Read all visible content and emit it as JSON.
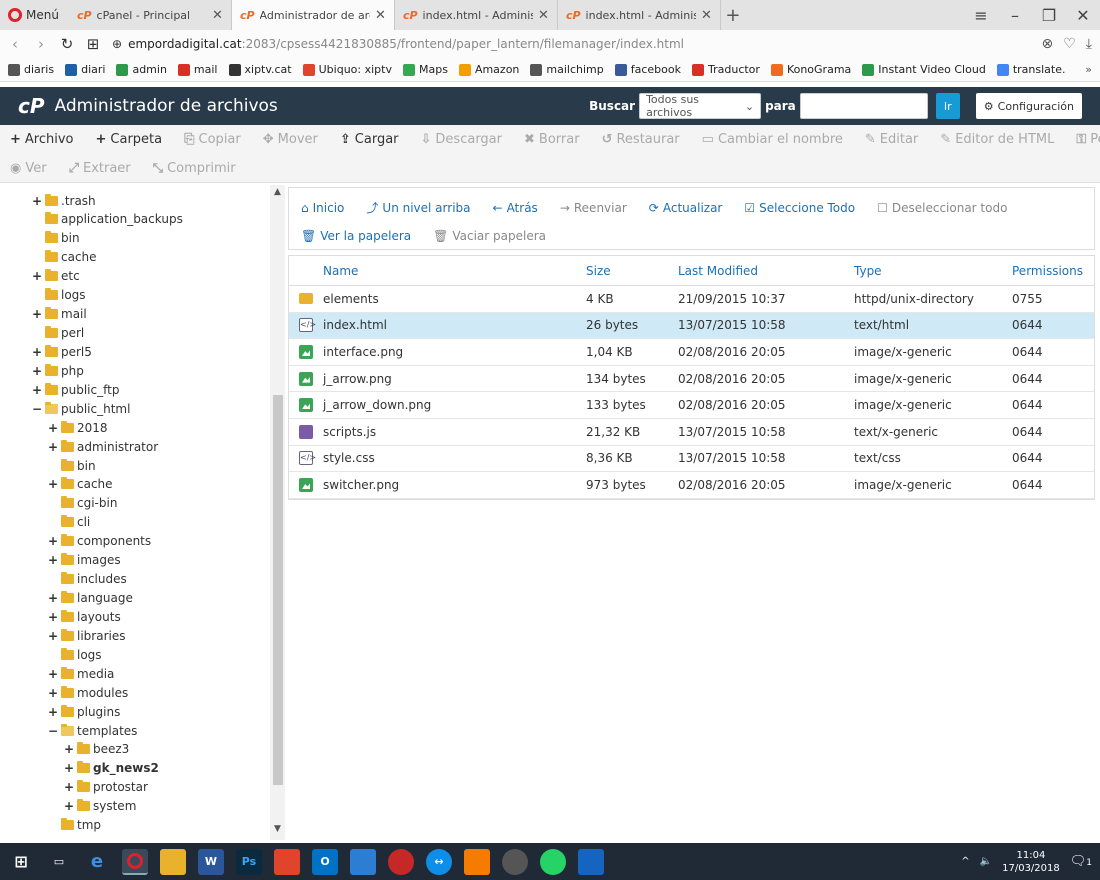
{
  "browser": {
    "menu_label": "Menú",
    "tabs": [
      {
        "title": "cPanel - Principal",
        "active": false
      },
      {
        "title": "Administrador de archivos",
        "active": true
      },
      {
        "title": "index.html - Administrado",
        "active": false
      },
      {
        "title": "index.html - Administrado",
        "active": false
      }
    ],
    "url_host": "empordadigital.cat",
    "url_rest": ":2083/cpsess4421830885/frontend/paper_lantern/filemanager/index.html",
    "bookmarks": [
      {
        "label": "diaris",
        "color": "#555555"
      },
      {
        "label": "diari",
        "color": "#1e5fa8"
      },
      {
        "label": "admin",
        "color": "#2c9a4a"
      },
      {
        "label": "mail",
        "color": "#d93025"
      },
      {
        "label": "xiptv.cat",
        "color": "#333333"
      },
      {
        "label": "Ubiquo: xiptv",
        "color": "#e0442a"
      },
      {
        "label": "Maps",
        "color": "#34a853"
      },
      {
        "label": "Amazon",
        "color": "#f0a000"
      },
      {
        "label": "mailchimp",
        "color": "#555555"
      },
      {
        "label": "facebook",
        "color": "#3b5998"
      },
      {
        "label": "Traductor",
        "color": "#d93025"
      },
      {
        "label": "KonoGrama",
        "color": "#f06a1f"
      },
      {
        "label": "Instant Video Cloud",
        "color": "#2c9a4a"
      },
      {
        "label": "translate.",
        "color": "#4285f4"
      }
    ]
  },
  "cpanel": {
    "logo": "cP",
    "title": "Administrador de archivos",
    "search_label": "Buscar",
    "search_scope": "Todos sus archivos",
    "for_label": "para",
    "go_label": "Ir",
    "config_label": "Configuración"
  },
  "toolbar": {
    "row1": [
      {
        "icon": "+",
        "label": "Archivo",
        "enabled": true
      },
      {
        "icon": "+",
        "label": "Carpeta",
        "enabled": true
      },
      {
        "icon": "⎘",
        "label": "Copiar",
        "enabled": false
      },
      {
        "icon": "✥",
        "label": "Mover",
        "enabled": false
      },
      {
        "icon": "⇪",
        "label": "Cargar",
        "enabled": true
      },
      {
        "icon": "⇩",
        "label": "Descargar",
        "enabled": false
      },
      {
        "icon": "✖",
        "label": "Borrar",
        "enabled": false
      },
      {
        "icon": "↺",
        "label": "Restaurar",
        "enabled": false
      },
      {
        "icon": "▭",
        "label": "Cambiar el nombre",
        "enabled": false
      },
      {
        "icon": "✎",
        "label": "Editar",
        "enabled": false
      },
      {
        "icon": "✎",
        "label": "Editor de HTML",
        "enabled": false
      },
      {
        "icon": "⚿",
        "label": "Permisos",
        "enabled": false
      }
    ],
    "row2": [
      {
        "icon": "◉",
        "label": "Ver",
        "enabled": false
      },
      {
        "icon": "⤢",
        "label": "Extraer",
        "enabled": false
      },
      {
        "icon": "⤡",
        "label": "Comprimir",
        "enabled": false
      }
    ]
  },
  "tree": [
    {
      "label": ".trash",
      "depth": 0,
      "toggle": "+",
      "open": false,
      "bold": false
    },
    {
      "label": "application_backups",
      "depth": 0,
      "toggle": "",
      "open": false,
      "bold": false
    },
    {
      "label": "bin",
      "depth": 0,
      "toggle": "",
      "open": false,
      "bold": false
    },
    {
      "label": "cache",
      "depth": 0,
      "toggle": "",
      "open": false,
      "bold": false
    },
    {
      "label": "etc",
      "depth": 0,
      "toggle": "+",
      "open": false,
      "bold": false
    },
    {
      "label": "logs",
      "depth": 0,
      "toggle": "",
      "open": false,
      "bold": false
    },
    {
      "label": "mail",
      "depth": 0,
      "toggle": "+",
      "open": false,
      "bold": false
    },
    {
      "label": "perl",
      "depth": 0,
      "toggle": "",
      "open": false,
      "bold": false
    },
    {
      "label": "perl5",
      "depth": 0,
      "toggle": "+",
      "open": false,
      "bold": false
    },
    {
      "label": "php",
      "depth": 0,
      "toggle": "+",
      "open": false,
      "bold": false
    },
    {
      "label": "public_ftp",
      "depth": 0,
      "toggle": "+",
      "open": false,
      "bold": false
    },
    {
      "label": "public_html",
      "depth": 0,
      "toggle": "−",
      "open": true,
      "bold": false
    },
    {
      "label": "2018",
      "depth": 1,
      "toggle": "+",
      "open": false,
      "bold": false
    },
    {
      "label": "administrator",
      "depth": 1,
      "toggle": "+",
      "open": false,
      "bold": false
    },
    {
      "label": "bin",
      "depth": 1,
      "toggle": "",
      "open": false,
      "bold": false
    },
    {
      "label": "cache",
      "depth": 1,
      "toggle": "+",
      "open": false,
      "bold": false
    },
    {
      "label": "cgi-bin",
      "depth": 1,
      "toggle": "",
      "open": false,
      "bold": false
    },
    {
      "label": "cli",
      "depth": 1,
      "toggle": "",
      "open": false,
      "bold": false
    },
    {
      "label": "components",
      "depth": 1,
      "toggle": "+",
      "open": false,
      "bold": false
    },
    {
      "label": "images",
      "depth": 1,
      "toggle": "+",
      "open": false,
      "bold": false
    },
    {
      "label": "includes",
      "depth": 1,
      "toggle": "",
      "open": false,
      "bold": false
    },
    {
      "label": "language",
      "depth": 1,
      "toggle": "+",
      "open": false,
      "bold": false
    },
    {
      "label": "layouts",
      "depth": 1,
      "toggle": "+",
      "open": false,
      "bold": false
    },
    {
      "label": "libraries",
      "depth": 1,
      "toggle": "+",
      "open": false,
      "bold": false
    },
    {
      "label": "logs",
      "depth": 1,
      "toggle": "",
      "open": false,
      "bold": false
    },
    {
      "label": "media",
      "depth": 1,
      "toggle": "+",
      "open": false,
      "bold": false
    },
    {
      "label": "modules",
      "depth": 1,
      "toggle": "+",
      "open": false,
      "bold": false
    },
    {
      "label": "plugins",
      "depth": 1,
      "toggle": "+",
      "open": false,
      "bold": false
    },
    {
      "label": "templates",
      "depth": 1,
      "toggle": "−",
      "open": true,
      "bold": false
    },
    {
      "label": "beez3",
      "depth": 2,
      "toggle": "+",
      "open": false,
      "bold": false
    },
    {
      "label": "gk_news2",
      "depth": 2,
      "toggle": "+",
      "open": false,
      "bold": true
    },
    {
      "label": "protostar",
      "depth": 2,
      "toggle": "+",
      "open": false,
      "bold": false
    },
    {
      "label": "system",
      "depth": 2,
      "toggle": "+",
      "open": false,
      "bold": false
    },
    {
      "label": "tmp",
      "depth": 1,
      "toggle": "",
      "open": false,
      "bold": false
    }
  ],
  "nav": {
    "row1": [
      {
        "icon": "⌂",
        "label": "Inicio",
        "enabled": true
      },
      {
        "icon": "⤴",
        "label": "Un nivel arriba",
        "enabled": true
      },
      {
        "icon": "←",
        "label": "Atrás",
        "enabled": true
      },
      {
        "icon": "→",
        "label": "Reenviar",
        "enabled": false
      },
      {
        "icon": "⟳",
        "label": "Actualizar",
        "enabled": true
      },
      {
        "icon": "☑",
        "label": "Seleccione Todo",
        "enabled": true
      },
      {
        "icon": "☐",
        "label": "Deseleccionar todo",
        "enabled": false
      }
    ],
    "row2": [
      {
        "icon": "🗑",
        "label": "Ver la papelera",
        "enabled": true
      },
      {
        "icon": "🗑",
        "label": "Vaciar papelera",
        "enabled": false
      }
    ]
  },
  "files": {
    "headers": {
      "name": "Name",
      "size": "Size",
      "modified": "Last Modified",
      "type": "Type",
      "perms": "Permissions"
    },
    "rows": [
      {
        "kind": "dir",
        "name": "elements",
        "size": "4 KB",
        "modified": "21/09/2015 10:37",
        "type": "httpd/unix-directory",
        "perms": "0755",
        "selected": false
      },
      {
        "kind": "code",
        "name": "index.html",
        "size": "26 bytes",
        "modified": "13/07/2015 10:58",
        "type": "text/html",
        "perms": "0644",
        "selected": true
      },
      {
        "kind": "img",
        "name": "interface.png",
        "size": "1,04 KB",
        "modified": "02/08/2016 20:05",
        "type": "image/x-generic",
        "perms": "0644",
        "selected": false
      },
      {
        "kind": "img",
        "name": "j_arrow.png",
        "size": "134 bytes",
        "modified": "02/08/2016 20:05",
        "type": "image/x-generic",
        "perms": "0644",
        "selected": false
      },
      {
        "kind": "img",
        "name": "j_arrow_down.png",
        "size": "133 bytes",
        "modified": "02/08/2016 20:05",
        "type": "image/x-generic",
        "perms": "0644",
        "selected": false
      },
      {
        "kind": "js",
        "name": "scripts.js",
        "size": "21,32 KB",
        "modified": "13/07/2015 10:58",
        "type": "text/x-generic",
        "perms": "0644",
        "selected": false
      },
      {
        "kind": "code",
        "name": "style.css",
        "size": "8,36 KB",
        "modified": "13/07/2015 10:58",
        "type": "text/css",
        "perms": "0644",
        "selected": false
      },
      {
        "kind": "img",
        "name": "switcher.png",
        "size": "973 bytes",
        "modified": "02/08/2016 20:05",
        "type": "image/x-generic",
        "perms": "0644",
        "selected": false
      }
    ]
  },
  "taskbar": {
    "time": "11:04",
    "date": "17/03/2018",
    "notification_count": "1"
  }
}
